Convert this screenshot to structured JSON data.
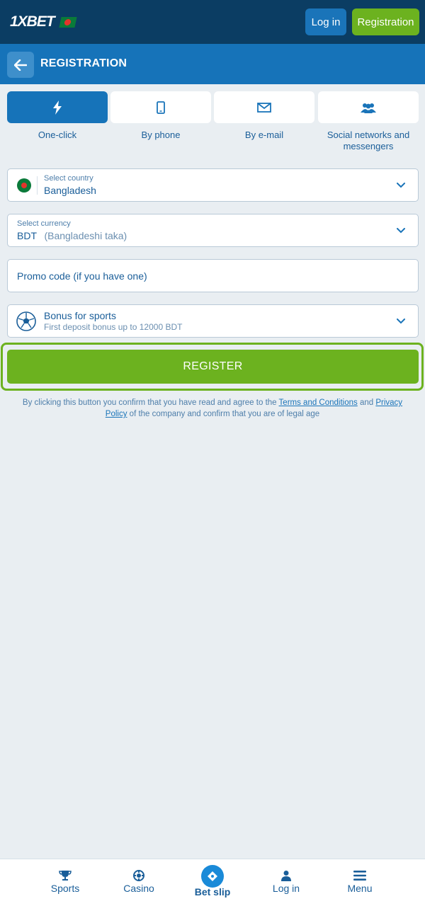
{
  "header": {
    "logo_text": "1XBET",
    "login_label": "Log in",
    "registration_label": "Registration"
  },
  "titlebar": {
    "title": "REGISTRATION"
  },
  "tabs": [
    {
      "label": "One-click",
      "icon": "lightning-icon",
      "active": true
    },
    {
      "label": "By phone",
      "icon": "phone-icon",
      "active": false
    },
    {
      "label": "By e-mail",
      "icon": "envelope-icon",
      "active": false
    },
    {
      "label": "Social networks and messengers",
      "icon": "people-icon",
      "active": false
    }
  ],
  "form": {
    "country": {
      "caption": "Select country",
      "value": "Bangladesh"
    },
    "currency": {
      "caption": "Select currency",
      "code": "BDT",
      "name": "(Bangladeshi taka)"
    },
    "promo": {
      "placeholder": "Promo code (if you have one)"
    },
    "bonus": {
      "title": "Bonus for sports",
      "subtitle": "First deposit bonus up to 12000 BDT"
    }
  },
  "register_label": "REGISTER",
  "disclaimer": {
    "part1": "By clicking this button you confirm that you have read and agree to the ",
    "terms_link": "Terms and Conditions",
    "and": " and ",
    "privacy_link": "Privacy Policy",
    "part2": " of the company and confirm that you are of legal age"
  },
  "bottom_nav": [
    {
      "label": "Sports",
      "icon": "trophy-icon"
    },
    {
      "label": "Casino",
      "icon": "chip-icon"
    },
    {
      "label": "Bet slip",
      "icon": "ticket-icon"
    },
    {
      "label": "Log in",
      "icon": "user-icon"
    },
    {
      "label": "Menu",
      "icon": "hamburger-icon"
    }
  ],
  "colors": {
    "header_bg": "#0b3d63",
    "titlebar_bg": "#1673b9",
    "accent_green": "#6cb21f",
    "text_blue": "#1a5e99",
    "page_bg": "#e9eef2"
  }
}
